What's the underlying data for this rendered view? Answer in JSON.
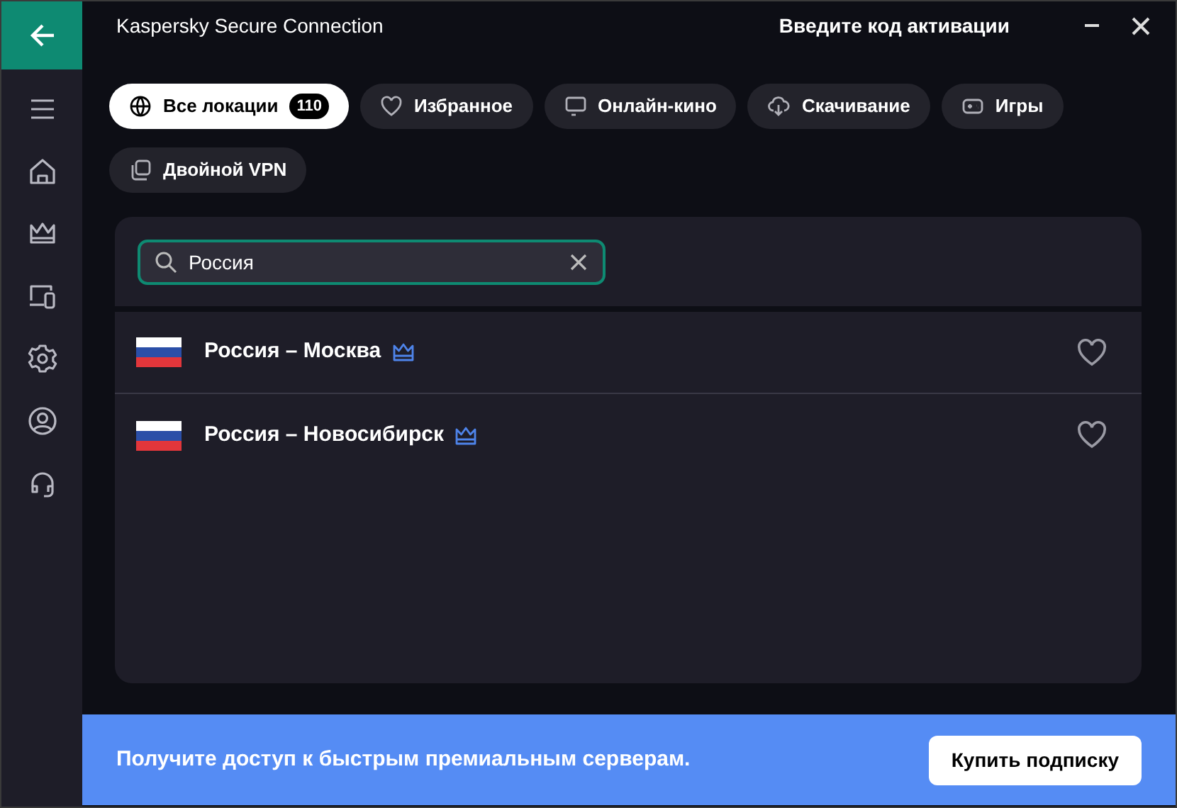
{
  "window": {
    "title": "Kaspersky Secure Connection",
    "activation_link": "Введите код активации"
  },
  "sidebar": {
    "items": [
      {
        "kind": "menu",
        "selected": false
      },
      {
        "kind": "home",
        "selected": false
      },
      {
        "kind": "crown",
        "selected": false
      },
      {
        "kind": "devices",
        "selected": false
      },
      {
        "kind": "settings",
        "selected": false
      },
      {
        "kind": "account",
        "selected": false
      },
      {
        "kind": "support",
        "selected": false
      }
    ]
  },
  "tabs": [
    {
      "label": "Все локации",
      "kind": "globe",
      "count": "110",
      "selected": true
    },
    {
      "label": "Избранное",
      "kind": "heart",
      "selected": false
    },
    {
      "label": "Онлайн-кино",
      "kind": "monitor",
      "selected": false
    },
    {
      "label": "Скачивание",
      "kind": "download",
      "selected": false
    },
    {
      "label": "Игры",
      "kind": "gamepad",
      "selected": false
    },
    {
      "label": "Двойной VPN",
      "kind": "copy",
      "selected": false
    }
  ],
  "search": {
    "value": "Россия"
  },
  "locations": [
    {
      "name": "Россия – Москва",
      "premium": true,
      "favorite": false
    },
    {
      "name": "Россия – Новосибирск",
      "premium": true,
      "favorite": false
    }
  ],
  "banner": {
    "text": "Получите доступ к быстрым премиальным серверам.",
    "button": "Купить подписку"
  }
}
